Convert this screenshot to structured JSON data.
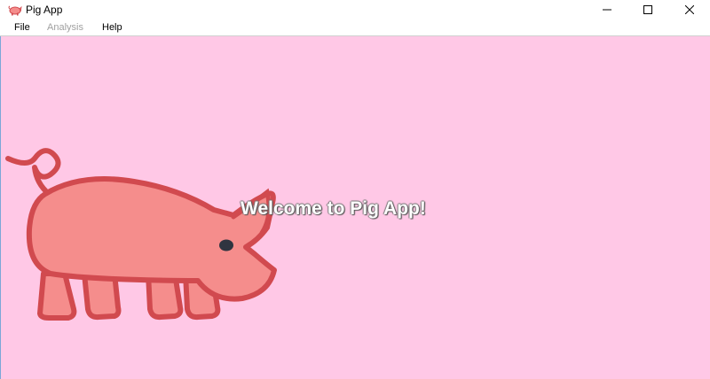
{
  "window": {
    "title": "Pig App",
    "icon": "pig-icon"
  },
  "menu": {
    "items": [
      {
        "label": "File",
        "enabled": true
      },
      {
        "label": "Analysis",
        "enabled": false
      },
      {
        "label": "Help",
        "enabled": true
      }
    ]
  },
  "content": {
    "welcome_text": "Welcome to Pig App!",
    "illustration": "pig-illustration",
    "background_color": "#ffc8e6"
  },
  "colors": {
    "pig_fill": "#f58d8c",
    "pig_outline": "#d14a4f",
    "pig_eye": "#2f3440"
  }
}
